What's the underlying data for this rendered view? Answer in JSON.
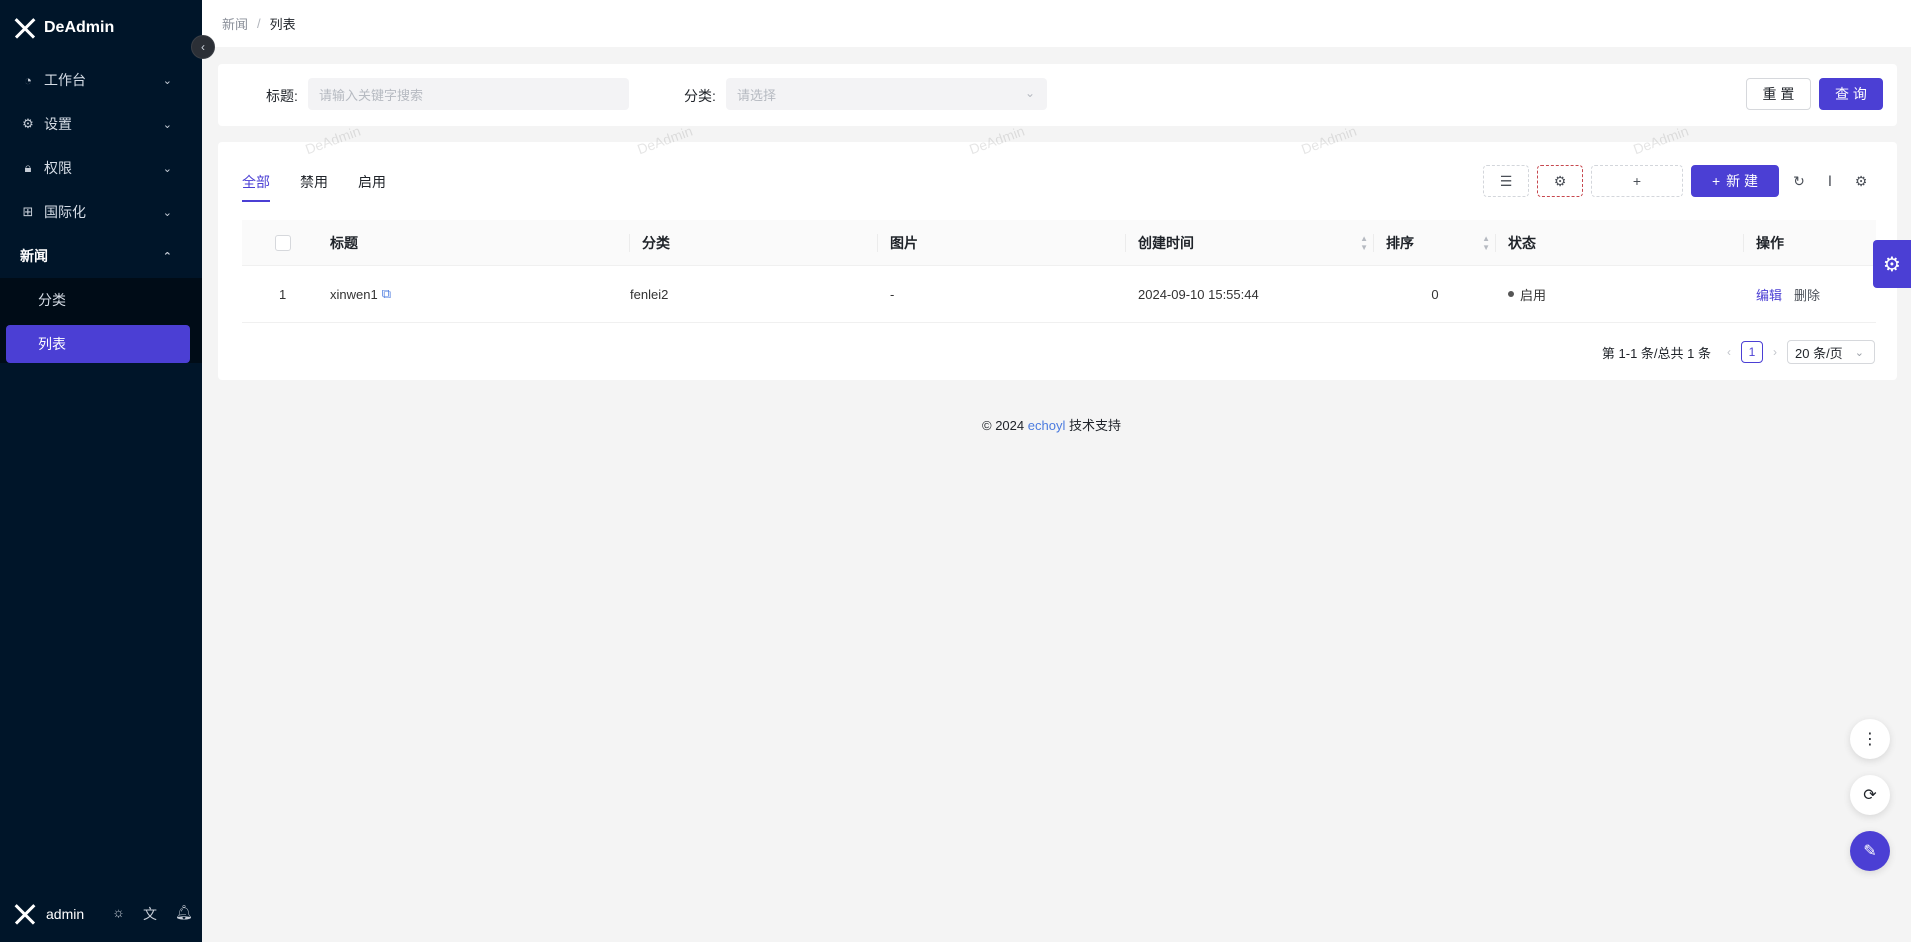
{
  "app": {
    "name": "DeAdmin"
  },
  "sidebar": {
    "items": [
      {
        "label": "工作台",
        "icon": "dashboard-icon"
      },
      {
        "label": "设置",
        "icon": "gear-icon"
      },
      {
        "label": "权限",
        "icon": "lock-icon"
      },
      {
        "label": "国际化",
        "icon": "i18n-icon"
      }
    ],
    "news_group": {
      "label": "新闻",
      "children": [
        "分类",
        "列表"
      ]
    },
    "user": "admin"
  },
  "breadcrumb": {
    "parent": "新闻",
    "separator": "/",
    "current": "列表"
  },
  "search": {
    "title_label": "标题:",
    "title_placeholder": "请输入关键字搜索",
    "category_label": "分类:",
    "category_placeholder": "请选择",
    "reset_label": "重 置",
    "query_label": "查 询"
  },
  "tabs": [
    "全部",
    "禁用",
    "启用"
  ],
  "toolbar": {
    "plus_small": "+",
    "new_label": "新 建"
  },
  "table": {
    "columns": [
      "标题",
      "分类",
      "图片",
      "创建时间",
      "排序",
      "状态",
      "操作"
    ],
    "rows": [
      {
        "index": "1",
        "title": "xinwen1",
        "category": "fenlei2",
        "image": "-",
        "created": "2024-09-10 15:55:44",
        "sort": "0",
        "status": "启用",
        "edit": "编辑",
        "delete": "删除"
      }
    ]
  },
  "pagination": {
    "summary": "第 1-1 条/总共 1 条",
    "page": "1",
    "page_size": "20 条/页"
  },
  "footer": {
    "prefix": "© 2024",
    "brand": "echoyl",
    "suffix": "技术支持"
  },
  "watermark": "DeAdmin",
  "colors": {
    "primary": "#4b3fd4",
    "sidebar": "#001529"
  }
}
